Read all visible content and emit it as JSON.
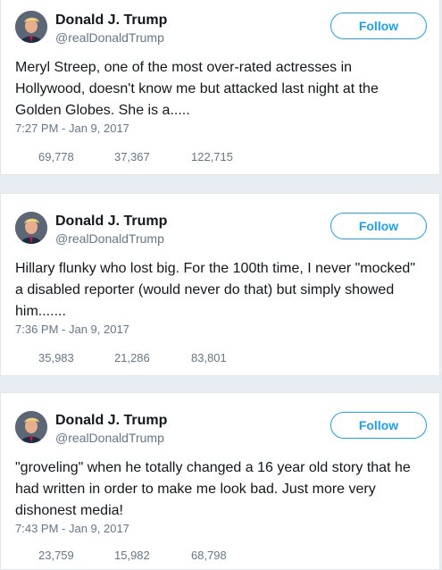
{
  "tweets": [
    {
      "name": "Donald J. Trump",
      "handle": "@realDonaldTrump",
      "follow_label": "Follow",
      "text": "Meryl Streep, one of the most over-rated actresses in Hollywood, doesn't know me but attacked last night at the Golden Globes. She is a.....",
      "time": "7:27 PM - Jan 9, 2017",
      "stats": [
        "69,778",
        "37,367",
        "122,715"
      ]
    },
    {
      "name": "Donald J. Trump",
      "handle": "@realDonaldTrump",
      "follow_label": "Follow",
      "text": "Hillary flunky who lost big. For the 100th time, I never \"mocked\" a disabled reporter (would never do that) but simply showed him.......",
      "time": "7:36 PM - Jan 9, 2017",
      "stats": [
        "35,983",
        "21,286",
        "83,801"
      ]
    },
    {
      "name": "Donald J. Trump",
      "handle": "@realDonaldTrump",
      "follow_label": "Follow",
      "text": "\"groveling\" when he totally changed a 16 year old story that he had written in order to make me look bad. Just more very dishonest media!",
      "time": "7:43 PM - Jan 9, 2017",
      "stats": [
        "23,759",
        "15,982",
        "68,798"
      ]
    }
  ],
  "colors": {
    "accent": "#1da1f2",
    "muted": "#657786",
    "background": "#e6ecf0"
  }
}
